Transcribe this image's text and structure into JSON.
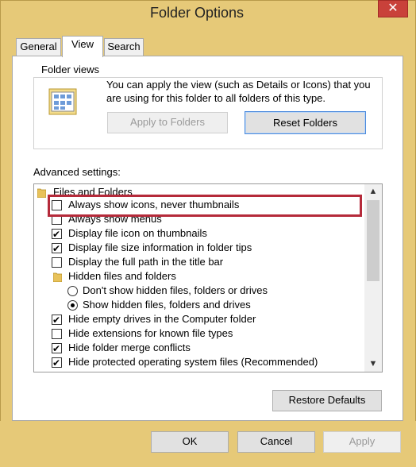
{
  "window": {
    "title": "Folder Options",
    "close_glyph": "✕"
  },
  "tabs": [
    {
      "label": "General",
      "active": false
    },
    {
      "label": "View",
      "active": true
    },
    {
      "label": "Search",
      "active": false
    }
  ],
  "folder_views": {
    "group_label": "Folder views",
    "description": "You can apply the view (such as Details or Icons) that you are using for this folder to all folders of this type.",
    "apply_button": "Apply to Folders",
    "reset_button": "Reset Folders",
    "icon": "folder-views-icon"
  },
  "advanced": {
    "label": "Advanced settings:",
    "items": [
      {
        "type": "folder",
        "label": "Files and Folders"
      },
      {
        "type": "checkbox",
        "checked": false,
        "label": "Always show icons, never thumbnails"
      },
      {
        "type": "checkbox",
        "checked": false,
        "label": "Always show menus"
      },
      {
        "type": "checkbox",
        "checked": true,
        "label": "Display file icon on thumbnails"
      },
      {
        "type": "checkbox",
        "checked": true,
        "label": "Display file size information in folder tips"
      },
      {
        "type": "checkbox",
        "checked": false,
        "label": "Display the full path in the title bar"
      },
      {
        "type": "folder",
        "label": "Hidden files and folders"
      },
      {
        "type": "radio",
        "checked": false,
        "label": "Don't show hidden files, folders or drives"
      },
      {
        "type": "radio",
        "checked": true,
        "label": "Show hidden files, folders and drives"
      },
      {
        "type": "checkbox",
        "checked": true,
        "label": "Hide empty drives in the Computer folder"
      },
      {
        "type": "checkbox",
        "checked": false,
        "label": "Hide extensions for known file types"
      },
      {
        "type": "checkbox",
        "checked": true,
        "label": "Hide folder merge conflicts"
      },
      {
        "type": "checkbox",
        "checked": true,
        "label": "Hide protected operating system files (Recommended)"
      }
    ]
  },
  "buttons": {
    "restore_defaults": "Restore Defaults",
    "ok": "OK",
    "cancel": "Cancel",
    "apply": "Apply"
  },
  "colors": {
    "window_frame": "#e6c978",
    "close_button": "#c9413a",
    "highlight": "#b52a3a"
  }
}
